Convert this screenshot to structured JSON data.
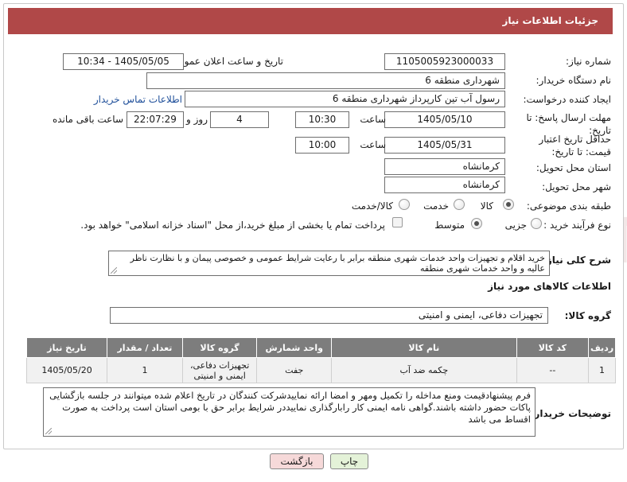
{
  "header": {
    "title": "جزئیات اطلاعات نیاز"
  },
  "form": {
    "need_number_label": "شماره نیاز:",
    "need_number": "1105005923000033",
    "announce_label": "تاریخ و ساعت اعلان عمومی:",
    "announce_value": "1405/05/05 - 10:34",
    "buyer_org_label": "نام دستگاه خریدار:",
    "buyer_org": "شهرداری منطقه 6",
    "creator_label": "ایجاد کننده درخواست:",
    "creator": "رسول آب تین کارپرداز شهرداری منطقه 6",
    "contact_link": "اطلاعات تماس خریدار",
    "reply_deadline_label": "مهلت ارسال پاسخ: تا تاریخ:",
    "reply_date": "1405/05/10",
    "time_label": "ساعت",
    "reply_time": "10:30",
    "days_value": "4",
    "days_label": "روز و",
    "remaining_time": "22:07:29",
    "remaining_label": "ساعت باقی مانده",
    "price_validity_label": "حداقل تاریخ اعتبار قیمت: تا تاریخ:",
    "price_date": "1405/05/31",
    "price_time": "10:00",
    "province_label": "استان محل تحویل:",
    "province": "کرمانشاه",
    "city_label": "شهر محل تحویل:",
    "city": "کرمانشاه",
    "category_label": "طبقه بندی موضوعی:",
    "category_options": [
      "کالا",
      "خدمت",
      "کالا/خدمت"
    ],
    "category_selected": "کالا",
    "process_label": "نوع فرآیند خرید :",
    "process_options": [
      "جزیی",
      "متوسط"
    ],
    "process_selected": "متوسط",
    "payment_note": "پرداخت تمام یا بخشی از مبلغ خرید،از محل \"اسناد خزانه اسلامی\" خواهد بود."
  },
  "description": {
    "label": "شرح کلی نیاز:",
    "text": "خرید اقلام و تجهیزات واحد خدمات شهری منطقه برابر با رعایت شرایط عمومی و خصوصی پیمان و با نظارت ناظر عالیه و واحد خدمات شهری منطقه"
  },
  "goods": {
    "section_title": "اطلاعات کالاهای مورد نیاز",
    "group_label": "گروه کالا:",
    "group_value": "تجهیزات دفاعی، ایمنی و امنیتی",
    "columns": [
      "ردیف",
      "کد کالا",
      "نام کالا",
      "واحد شمارش",
      "گروه کالا",
      "تعداد / مقدار",
      "تاریخ نیاز"
    ],
    "rows": [
      [
        "1",
        "--",
        "چکمه ضد آب",
        "جفت",
        "تجهیزات دفاعی، ایمنی و امنیتی",
        "1",
        "1405/05/20"
      ]
    ]
  },
  "buyer_notes": {
    "label": "توضیحات خریدار:",
    "text": "فرم پیشنهادقیمت ومنع مداخله را تکمیل ومهر و امضا ارائه نماییدشرکت کنندگان در تاریخ اعلام شده میتوانند در جلسه بازگشایی پاکات حضور داشته باشند.گواهی نامه ایمنی کار رابارگذاری نماییددر شرایط برابر حق با بومی استان است پرداخت به صورت اقساط می باشد"
  },
  "buttons": {
    "print": "چاپ",
    "back": "بازگشت"
  },
  "colors": {
    "header": "#b04848",
    "table_header": "#7d7d7d",
    "link": "#1f4f9a",
    "back_button": "#f6d9d9",
    "print_button": "#e4f2d8"
  }
}
